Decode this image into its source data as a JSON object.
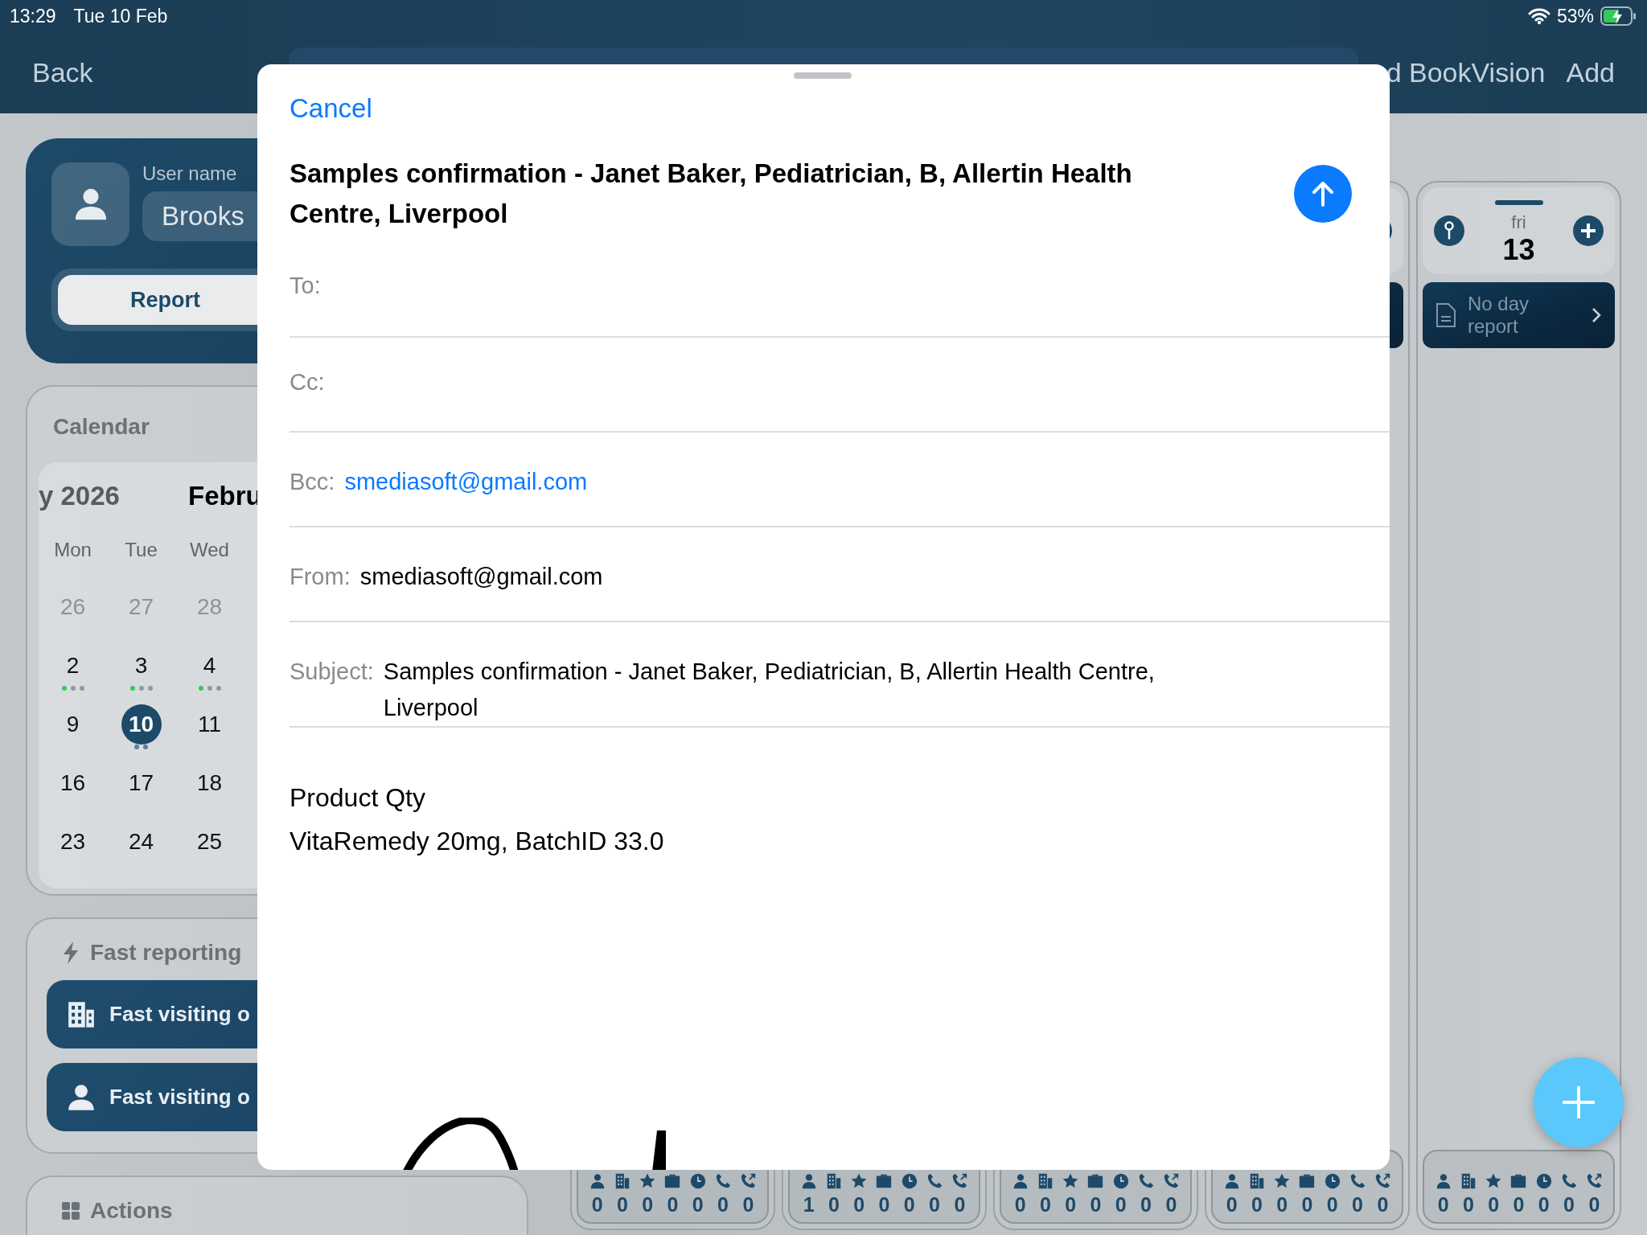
{
  "status_bar": {
    "time": "13:29",
    "date": "Tue 10 Feb",
    "battery": "53%"
  },
  "nav": {
    "back": "Back",
    "title": "d BookVision",
    "add": "Add"
  },
  "user_card": {
    "label": "User name",
    "name": "Brooks",
    "report_button": "Report"
  },
  "calendar": {
    "title": "Calendar",
    "year": "y 2026",
    "month": "Febru",
    "weekdays": [
      "Mon",
      "Tue",
      "Wed"
    ],
    "weeks": [
      [
        {
          "day": "26",
          "muted": true,
          "selected": false
        },
        {
          "day": "27",
          "muted": true,
          "selected": false
        },
        {
          "day": "28",
          "muted": true,
          "selected": false
        }
      ],
      [
        {
          "day": "2",
          "muted": false,
          "selected": false,
          "dots": [
            {
              "color": "#34c759"
            },
            {
              "color": "#8e99a4"
            },
            {
              "color": "#8e99a4"
            }
          ]
        },
        {
          "day": "3",
          "muted": false,
          "selected": false,
          "dots": [
            {
              "color": "#34c759"
            },
            {
              "color": "#8e99a4"
            },
            {
              "color": "#8e99a4"
            }
          ]
        },
        {
          "day": "4",
          "muted": false,
          "selected": false,
          "dots": [
            {
              "color": "#34c759"
            },
            {
              "color": "#8e99a4"
            },
            {
              "color": "#8e99a4"
            }
          ]
        }
      ],
      [
        {
          "day": "9",
          "muted": false,
          "selected": false
        },
        {
          "day": "10",
          "muted": false,
          "selected": true,
          "dots": [
            {
              "color": "#5b7f9c"
            },
            {
              "color": "#5b7f9c"
            }
          ]
        },
        {
          "day": "11",
          "muted": false,
          "selected": false
        }
      ],
      [
        {
          "day": "16",
          "muted": false,
          "selected": false
        },
        {
          "day": "17",
          "muted": false,
          "selected": false
        },
        {
          "day": "18",
          "muted": false,
          "selected": false
        }
      ],
      [
        {
          "day": "23",
          "muted": false,
          "selected": false
        },
        {
          "day": "24",
          "muted": false,
          "selected": false
        },
        {
          "day": "25",
          "muted": false,
          "selected": false
        }
      ]
    ]
  },
  "fast_reporting": {
    "title": "Fast reporting",
    "buttons": [
      {
        "label": "Fast visiting o",
        "kind": "building"
      },
      {
        "label": "Fast visiting o",
        "kind": "person"
      }
    ]
  },
  "actions": {
    "title": "Actions"
  },
  "day_columns": [
    {
      "kind": "empty",
      "counters": [
        "0",
        "0",
        "0",
        "0",
        "0",
        "0",
        "0"
      ]
    },
    {
      "kind": "empty",
      "counters": [
        "1",
        "0",
        "0",
        "0",
        "0",
        "0",
        "0"
      ]
    },
    {
      "kind": "empty",
      "counters": [
        "0",
        "0",
        "0",
        "0",
        "0",
        "0",
        "0"
      ]
    },
    {
      "kind": "partial",
      "counters": [
        "0",
        "0",
        "0",
        "0",
        "0",
        "0",
        "0"
      ]
    },
    {
      "kind": "full",
      "weekday": "fri",
      "day": "13",
      "report": "No day report",
      "counters": [
        "0",
        "0",
        "0",
        "0",
        "0",
        "0",
        "0"
      ]
    }
  ],
  "compose": {
    "cancel": "Cancel",
    "title": "Samples confirmation - Janet Baker, Pediatrician, B, Allertin Health Centre, Liverpool",
    "fields": [
      {
        "label": "To:",
        "kind": "empty"
      },
      {
        "label": "Cc:",
        "kind": "empty"
      },
      {
        "label": "Bcc:",
        "kind": "link",
        "value": "smediasoft@gmail.com"
      },
      {
        "label": "From:",
        "kind": "plain",
        "value": "smediasoft@gmail.com"
      },
      {
        "label": "Subject:",
        "kind": "plain",
        "value": "Samples confirmation - Janet Baker, Pediatrician, B, Allertin Health Centre, Liverpool"
      }
    ],
    "body": [
      "Product Qty",
      "VitaRemedy 20mg, BatchID 33.0"
    ]
  }
}
